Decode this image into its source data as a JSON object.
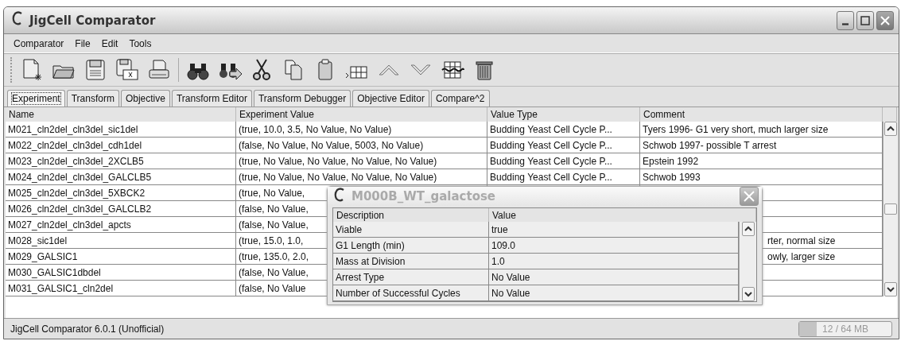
{
  "window": {
    "title": "JigCell Comparator"
  },
  "menu": [
    "Comparator",
    "File",
    "Edit",
    "Tools"
  ],
  "tabs": [
    {
      "label": "Experiment",
      "selected": true
    },
    {
      "label": "Transform",
      "selected": false
    },
    {
      "label": "Objective",
      "selected": false
    },
    {
      "label": "Transform Editor",
      "selected": false
    },
    {
      "label": "Transform Debugger",
      "selected": false
    },
    {
      "label": "Objective Editor",
      "selected": false
    },
    {
      "label": "Compare^2",
      "selected": false
    }
  ],
  "table": {
    "columns": [
      "Name",
      "Experiment Value",
      "Value Type",
      "Comment"
    ],
    "rows": [
      {
        "name": "M021_cln2del_cln3del_sic1del",
        "experiment_value": "(true, 10.0, 3.5, No Value, No Value)",
        "value_type": "Budding Yeast Cell Cycle P...",
        "comment": "Tyers 1996- G1 very short, much larger size",
        "covered": false
      },
      {
        "name": "M022_cln2del_cln3del_cdh1del",
        "experiment_value": "(false, No Value, No Value, 5003, No Value)",
        "value_type": "Budding Yeast Cell Cycle P...",
        "comment": "Schwob 1997- possible T arrest",
        "covered": false
      },
      {
        "name": "M023_cln2del_cln3del_2XCLB5",
        "experiment_value": "(true, No Value, No Value, No Value, No Value)",
        "value_type": "Budding Yeast Cell Cycle P...",
        "comment": "Epstein 1992",
        "covered": false
      },
      {
        "name": "M024_cln2del_cln3del_GALCLB5",
        "experiment_value": "(true, No Value, No Value, No Value, No Value)",
        "value_type": "Budding Yeast Cell Cycle P...",
        "comment": "Schwob 1993",
        "covered": false
      },
      {
        "name": "M025_cln2del_cln3del_5XBCK2",
        "experiment_value": "(true, No Value,",
        "covered": true
      },
      {
        "name": "M026_cln2del_cln3del_GALCLB2",
        "experiment_value": "(false, No Value,",
        "covered": true
      },
      {
        "name": "M027_cln2del_cln3del_apcts",
        "experiment_value": "(false, No Value,",
        "covered": true
      },
      {
        "name": "M028_sic1del",
        "experiment_value": "(true, 15.0, 1.0,",
        "comment": "rter, normal size",
        "covered": true
      },
      {
        "name": "M029_GALSIC1",
        "experiment_value": "(true, 135.0, 2.0,",
        "comment": "owly, larger size",
        "covered": true
      },
      {
        "name": "M030_GALSIC1dbdel",
        "experiment_value": "(false, No Value,",
        "covered": true
      },
      {
        "name": "M031_GALSIC1_cln2del",
        "experiment_value": "(false, No Value",
        "covered": true
      }
    ]
  },
  "dialog": {
    "title": "M000B_WT_galactose",
    "columns": [
      "Description",
      "Value"
    ],
    "rows": [
      {
        "description": "Viable",
        "value": "true"
      },
      {
        "description": "G1 Length (min)",
        "value": "109.0"
      },
      {
        "description": "Mass at Division",
        "value": "1.0"
      },
      {
        "description": "Arrest Type",
        "value": "No Value"
      },
      {
        "description": "Number of Successful Cycles",
        "value": "No Value"
      }
    ]
  },
  "status_bar": {
    "text": "JigCell Comparator 6.0.1 (Unofficial)",
    "memory": {
      "reading": "12 / 64 MB",
      "level": 0.19
    }
  }
}
